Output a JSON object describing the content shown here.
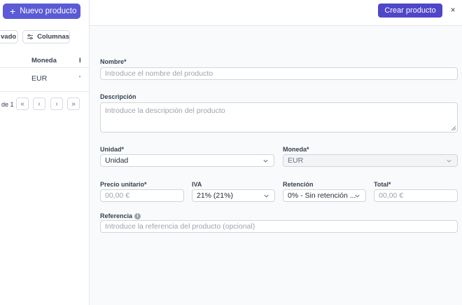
{
  "background": {
    "new_product_label": "Nuevo producto",
    "archived_label": "vado",
    "columns_label": "Columnas",
    "table": {
      "headers": [
        "Moneda",
        "I"
      ],
      "rows": [
        {
          "lead": ")",
          "currency": "EUR",
          "extra": "'"
        }
      ]
    },
    "pagination_text": "de 1"
  },
  "panel": {
    "create_label": "Crear producto",
    "close_label": "×",
    "name": {
      "label": "Nombre*",
      "placeholder": "Introduce el nombre del producto"
    },
    "description": {
      "label": "Descripción",
      "placeholder": "Introduce la descripción del producto"
    },
    "unit": {
      "label": "Unidad*",
      "value": "Unidad"
    },
    "currency": {
      "label": "Moneda*",
      "value": "EUR"
    },
    "unit_price": {
      "label": "Precio unitario*",
      "placeholder": "00,00 €"
    },
    "vat": {
      "label": "IVA",
      "value": "21% (21%)"
    },
    "retention": {
      "label": "Retención",
      "value": "0% - Sin retención ..."
    },
    "total": {
      "label": "Total*",
      "placeholder": "00,00 €"
    },
    "reference": {
      "label": "Referencia",
      "placeholder": "Introduce la referencia del producto (opcional)"
    }
  },
  "colors": {
    "primary": "#5b5bd6",
    "primary_dark": "#4f46c8"
  }
}
